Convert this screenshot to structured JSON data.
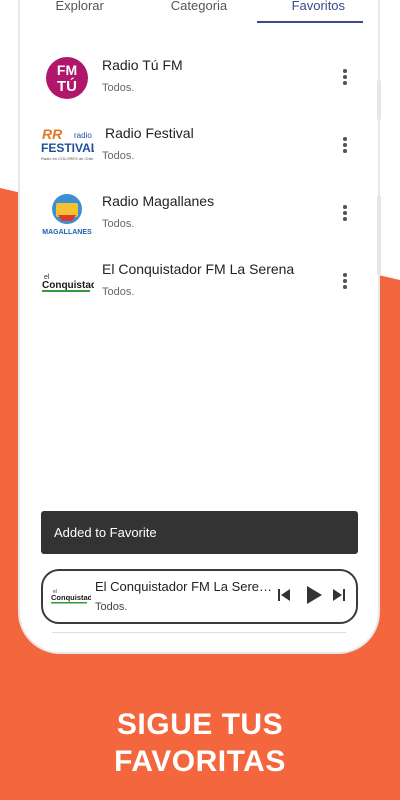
{
  "tabs": [
    {
      "label": "Explorar"
    },
    {
      "label": "Categoria"
    },
    {
      "label": "Favoritos",
      "active": true
    }
  ],
  "favorites": [
    {
      "name": "Radio Tú FM",
      "subtitle": "Todos.",
      "logo_text": "FM TÚ",
      "logo_color": "#b0176b"
    },
    {
      "name": "Radio Festival",
      "subtitle": "Todos.",
      "logo_text": "FESTIVAL",
      "logo_color": "#1e4f9c",
      "logo_line": "Radio en COLORES de Chile",
      "logo_top": "radio"
    },
    {
      "name": "Radio Magallanes",
      "subtitle": "Todos.",
      "logo_text": "MAGALLANES",
      "logo_color": "#1c5fb0"
    },
    {
      "name": "El Conquistador FM La Serena",
      "subtitle": "Todos.",
      "logo_text": "Conquistador",
      "logo_pre": "el",
      "logo_color": "#1a1a1a"
    }
  ],
  "toast": {
    "message": "Added to Favorite"
  },
  "player": {
    "title": "El Conquistador FM La Serena",
    "subtitle": "Todos.",
    "logo_text": "Conquistador",
    "logo_pre": "el"
  },
  "promo": {
    "line1": "SIGUE TUS",
    "line2": "FAVORITAS"
  },
  "colors": {
    "accent": "#3a4a8c",
    "background": "#f4673e",
    "toast": "#333333"
  }
}
